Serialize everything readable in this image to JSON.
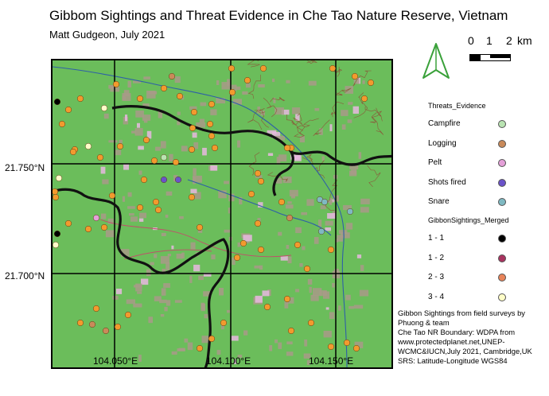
{
  "title": "Gibbom Sightings and Threat Evidence in Che Tao Nature Reserve, Vietnam",
  "subtitle": "Matt Gudgeon,  July 2021",
  "axes": {
    "y_labels": [
      "21.750°N",
      "21.700°N"
    ],
    "x_labels": [
      "104.050°E",
      "104.100°E",
      "104.150°E"
    ]
  },
  "scale": {
    "ticks": [
      "0",
      "1",
      "2"
    ],
    "unit": "km"
  },
  "legend": {
    "threats_title": "Threats_Evidence",
    "threats": [
      {
        "label": "Campfire",
        "color": "#b9e3b2"
      },
      {
        "label": "Logging",
        "color": "#c98a5a"
      },
      {
        "label": "Pelt",
        "color": "#e4a0d8"
      },
      {
        "label": "Shots fired",
        "color": "#6a52c9"
      },
      {
        "label": "Snare",
        "color": "#7fb9c2"
      }
    ],
    "sightings_title": "GibbonSightings_Merged",
    "sightings": [
      {
        "label": "1 - 1",
        "color": "#000000"
      },
      {
        "label": "1 - 2",
        "color": "#a8335f"
      },
      {
        "label": "2 - 3",
        "color": "#e8845a"
      },
      {
        "label": "3 - 4",
        "color": "#fffdc8"
      }
    ]
  },
  "credits": [
    "Gibbon Sightings from field surveys by",
    "Phuong & team",
    "Che Tao NR Boundary: WDPA from",
    "www.protectedplanet.net,UNEP-",
    "WCMC&IUCN,July 2021, Cambridge,UK",
    "SRS: Latitude-Longitude WGS84"
  ],
  "icons": {
    "north_arrow": "north-arrow-icon"
  },
  "colors": {
    "landcover_green": "#6bbd5b",
    "bare_patch": "#a89a88",
    "river": "#2e5fa8",
    "road": "#c0506a",
    "contour": "#8a5a3a",
    "boundary": "#000000",
    "sighting_dot": "#f29a2e",
    "north_arrow": "#3aa13a"
  }
}
